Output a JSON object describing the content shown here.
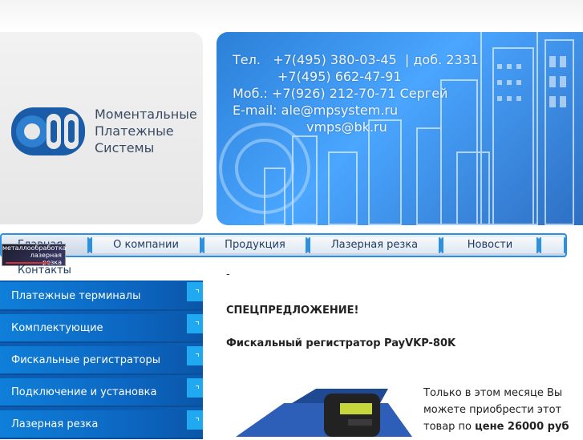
{
  "logo": {
    "line1": "Моментальные",
    "line2": "Платежные",
    "line3": "Системы"
  },
  "contact": {
    "tel_label": "Тел.",
    "tel1": "+7(495) 380-03-45",
    "ext": "доб. 2331",
    "tel2": "+7(495) 662-47-91",
    "mob": "Моб.: +7(926) 212-70-71 Сергей",
    "email": "E-mail: ale@mpsystem.ru",
    "email2": "vmps@bk.ru"
  },
  "nav": {
    "home": "Главная",
    "about": "О компании",
    "products": "Продукция",
    "laser": "Лазерная резка",
    "news": "Новости",
    "contacts": "Контакты"
  },
  "badge": {
    "line1": "металлообработка",
    "line2": "лазерная",
    "line3": "резка"
  },
  "sidebar": {
    "items": [
      {
        "label": "Платежные терминалы"
      },
      {
        "label": "Комплектующие"
      },
      {
        "label": "Фискальные регистраторы"
      },
      {
        "label": "Подключение и установка"
      },
      {
        "label": "Лазерная резка"
      }
    ]
  },
  "content": {
    "dash": "-",
    "special": "СПЕЦПРЕДЛОЖЕНИЕ!",
    "product_title": "Фискальный регистратор PayVKP-80K",
    "desc_part1": "Только в этом месяце Вы можете приобрести этот товар по",
    "desc_price": "цене 26000 руб"
  },
  "colors": {
    "nav_border": "#2d8fe0",
    "sidebar_bg": "#0c66c0",
    "banner_blue": "#3b8fe8"
  }
}
